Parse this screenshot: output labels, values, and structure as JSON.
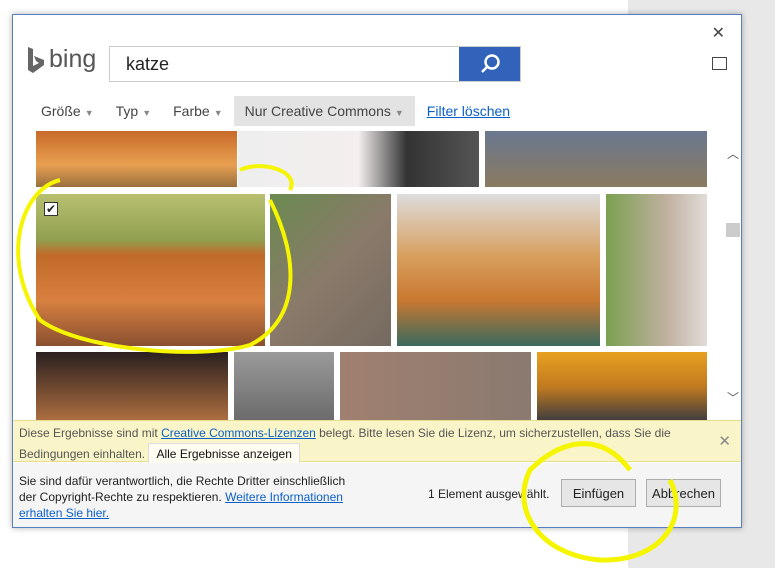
{
  "dialog": {
    "close_icon": "close-icon",
    "feedback_icon": "speech-bubble-icon"
  },
  "logo": {
    "text": "bing"
  },
  "search": {
    "value": "katze",
    "button_icon": "search-icon"
  },
  "filters": [
    {
      "label": "Größe"
    },
    {
      "label": "Typ"
    },
    {
      "label": "Farbe"
    },
    {
      "label": "Nur Creative Commons"
    }
  ],
  "filter_clear": "Filter löschen",
  "notice": {
    "text1": "Diese Ergebnisse sind mit ",
    "link": "Creative Commons-Lizenzen",
    "text2": " belegt. Bitte lesen Sie die Lizenz, um sicherzustellen, dass Sie die Bedingungen einhalten.",
    "button": "Alle Ergebnisse anzeigen"
  },
  "footer": {
    "text": "Sie sind dafür verantwortlich, die Rechte Dritter einschließlich der Copyright-Rechte zu respektieren. ",
    "link": "Weitere Informationen erhalten Sie hier.",
    "selected": "1 Element ausgewählt.",
    "insert": "Einfügen",
    "cancel": "Abbrechen"
  },
  "colors": {
    "accent": "#3063b9",
    "annotation": "#f5f500"
  }
}
